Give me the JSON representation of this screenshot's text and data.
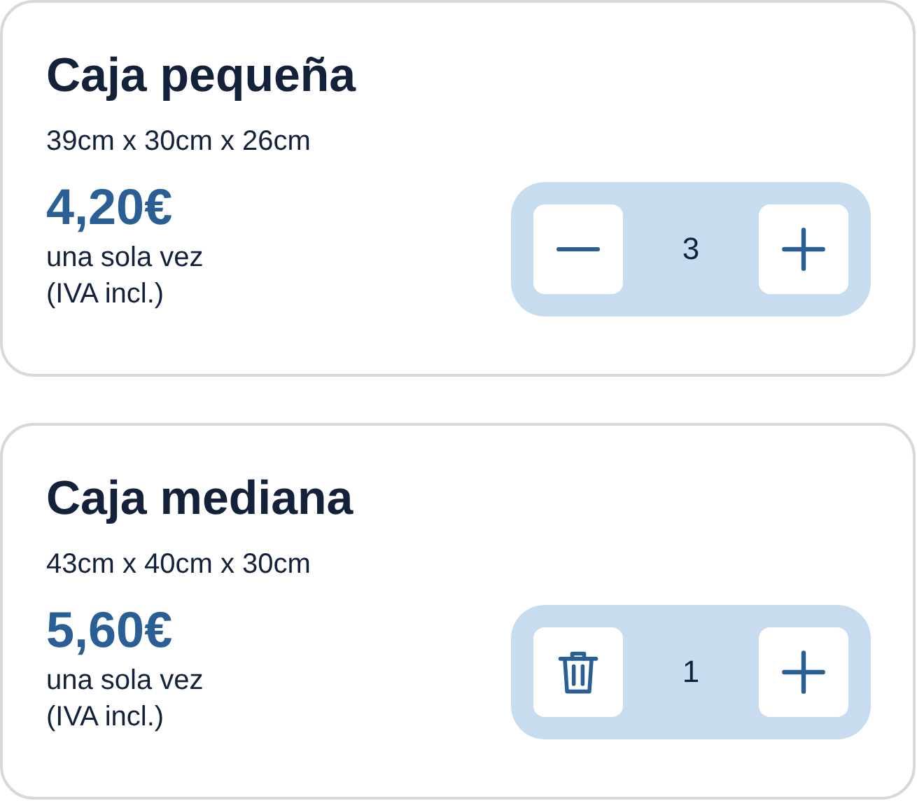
{
  "products": [
    {
      "name": "Caja pequeña",
      "dimensions": "39cm x 30cm x 26cm",
      "price": "4,20€",
      "frequency": "una sola vez",
      "tax_note": "(IVA incl.)",
      "quantity": "3",
      "decrement_button": {
        "kind": "minus"
      }
    },
    {
      "name": "Caja mediana",
      "dimensions": "43cm x 40cm x 30cm",
      "price": "5,60€",
      "frequency": "una sola vez",
      "tax_note": "(IVA incl.)",
      "quantity": "1",
      "decrement_button": {
        "kind": "trash"
      }
    }
  ]
}
